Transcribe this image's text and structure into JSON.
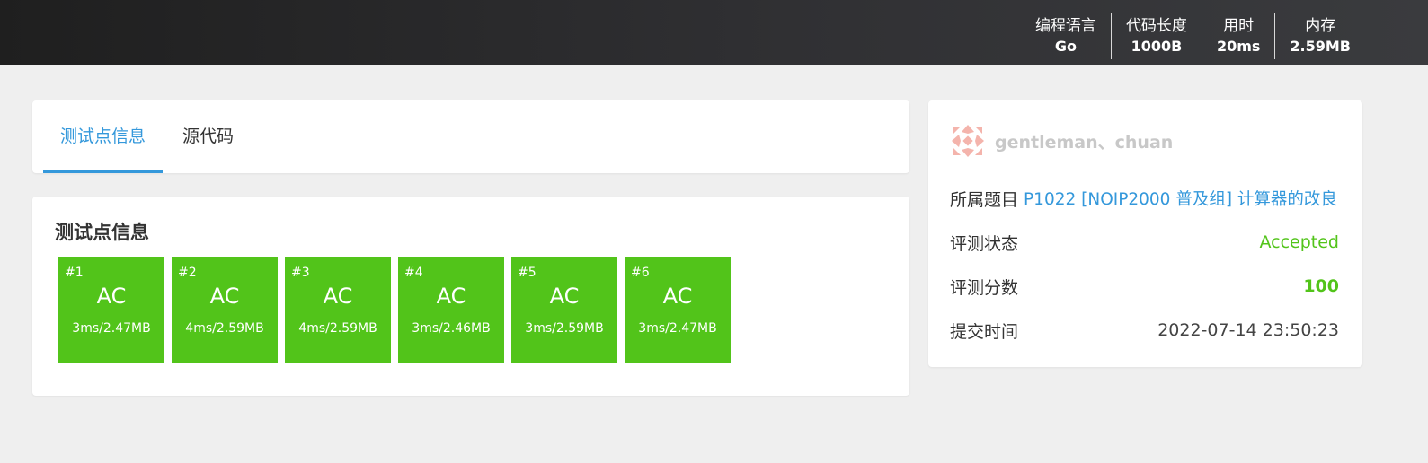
{
  "header": {
    "stats": [
      {
        "label": "编程语言",
        "value": "Go"
      },
      {
        "label": "代码长度",
        "value": "1000B"
      },
      {
        "label": "用时",
        "value": "20ms"
      },
      {
        "label": "内存",
        "value": "2.59MB"
      }
    ]
  },
  "tabs": {
    "active": "测试点信息",
    "source": "源代码"
  },
  "testcases": {
    "title": "测试点信息",
    "items": [
      {
        "id": "#1",
        "status": "AC",
        "detail": "3ms/2.47MB"
      },
      {
        "id": "#2",
        "status": "AC",
        "detail": "4ms/2.59MB"
      },
      {
        "id": "#3",
        "status": "AC",
        "detail": "4ms/2.59MB"
      },
      {
        "id": "#4",
        "status": "AC",
        "detail": "3ms/2.46MB"
      },
      {
        "id": "#5",
        "status": "AC",
        "detail": "3ms/2.59MB"
      },
      {
        "id": "#6",
        "status": "AC",
        "detail": "3ms/2.47MB"
      }
    ]
  },
  "info": {
    "username": "gentleman、chuan",
    "problem_label": "所属题目",
    "problem": "P1022 [NOIP2000 普及组] 计算器的改良",
    "status_label": "评测状态",
    "status": "Accepted",
    "score_label": "评测分数",
    "score": "100",
    "time_label": "提交时间",
    "time": "2022-07-14 23:50:23"
  },
  "colors": {
    "accent": "#3498db",
    "accepted": "#52c41a",
    "avatar": "#f4b4ac"
  },
  "icons": {
    "avatar": "identicon-avatar-icon"
  }
}
